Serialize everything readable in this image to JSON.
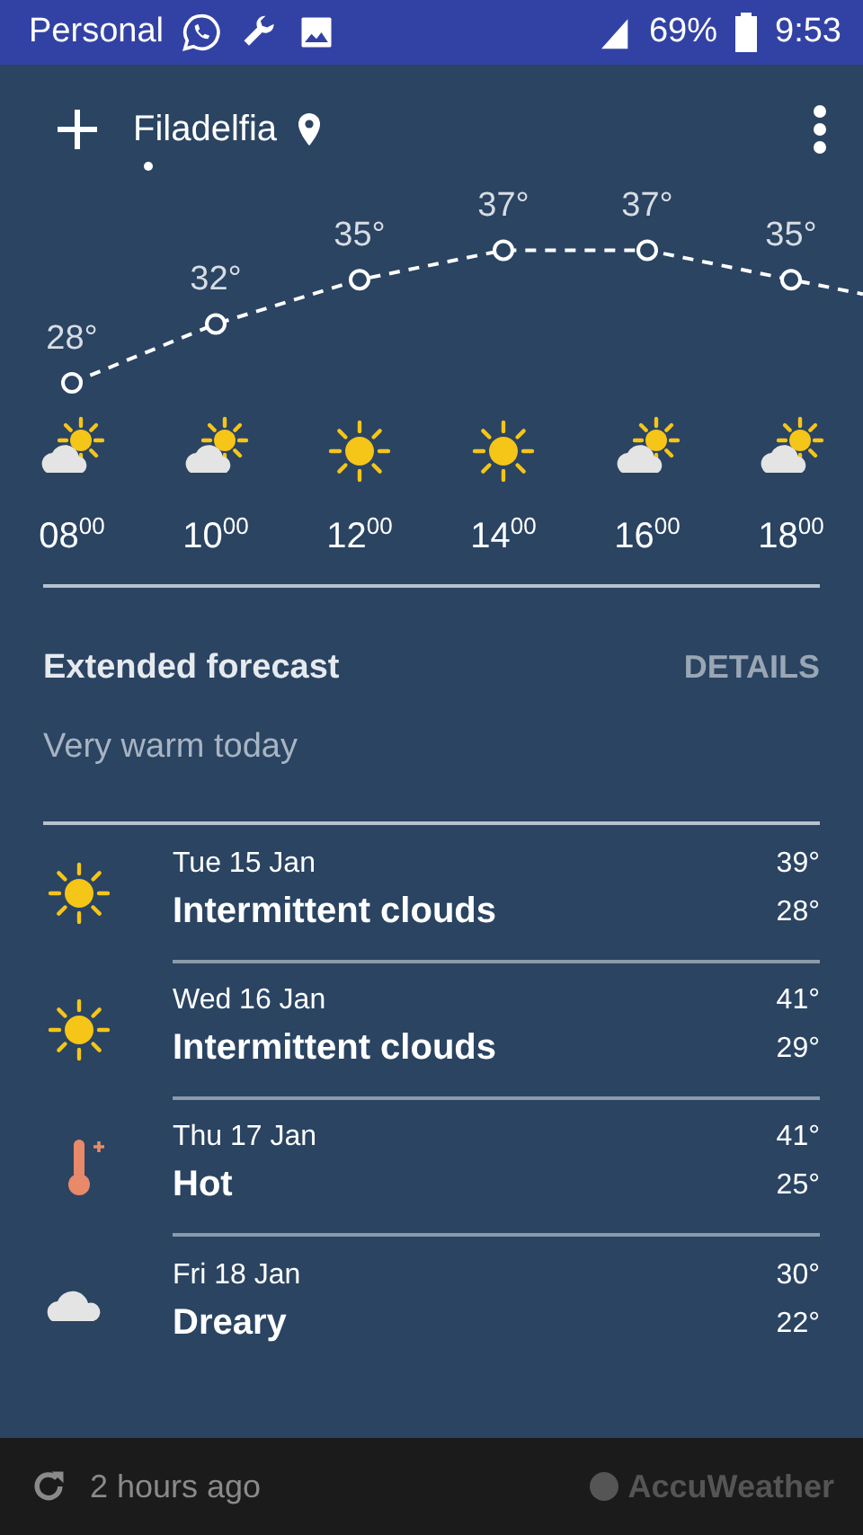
{
  "status_bar": {
    "carrier": "Personal",
    "battery": "69%",
    "time": "9:53"
  },
  "header": {
    "city": "Filadelfia"
  },
  "hourly": [
    {
      "temp": "28°",
      "time": "08$^{00}$",
      "kind": "partly-cloudy"
    },
    {
      "temp": "32°",
      "time": "10$^{00}$",
      "kind": "partly-cloudy"
    },
    {
      "temp": "35°",
      "time": "12$^{00}$",
      "kind": "sunny"
    },
    {
      "temp": "37°",
      "time": "14$^{00}$",
      "kind": "sunny"
    },
    {
      "temp": "37°",
      "time": "16$^{00}$",
      "kind": "partly-cloudy"
    },
    {
      "temp": "35°",
      "time": "18$^{00}$",
      "kind": "partly-cloudy"
    }
  ],
  "extended": {
    "title": "Extended forecast",
    "action": "DETAILS",
    "summary": "Very warm today"
  },
  "days": [
    {
      "date": "Tue 15 Jan",
      "condition": "Intermittent clouds",
      "high": "39°",
      "low": "28°",
      "kind": "sunny"
    },
    {
      "date": "Wed 16 Jan",
      "condition": "Intermittent clouds",
      "high": "41°",
      "low": "29°",
      "kind": "sunny"
    },
    {
      "date": "Thu 17 Jan",
      "condition": "Hot",
      "high": "41°",
      "low": "25°",
      "kind": "hot"
    },
    {
      "date": "Fri 18 Jan",
      "condition": "Dreary",
      "high": "30°",
      "low": "22°",
      "kind": "cloudy"
    }
  ],
  "footer": {
    "updated": "2 hours ago",
    "brand": "AccuWeather"
  }
}
